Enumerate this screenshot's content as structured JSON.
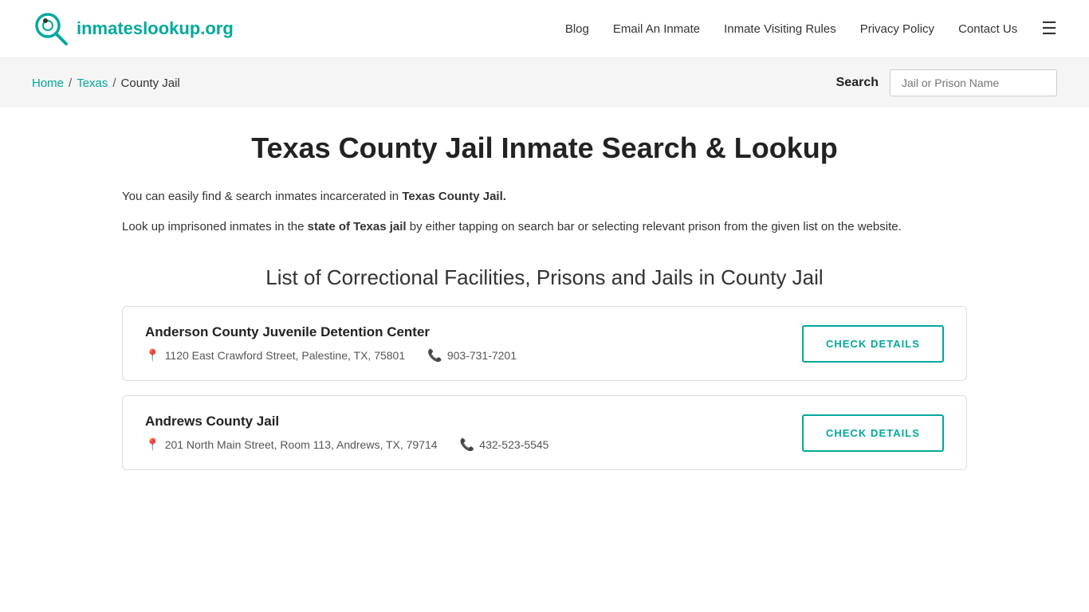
{
  "header": {
    "logo_text_regular": "inmates",
    "logo_text_bold": "lookup.org",
    "nav": [
      {
        "label": "Blog",
        "href": "#"
      },
      {
        "label": "Email An Inmate",
        "href": "#"
      },
      {
        "label": "Inmate Visiting Rules",
        "href": "#"
      },
      {
        "label": "Privacy Policy",
        "href": "#"
      },
      {
        "label": "Contact Us",
        "href": "#"
      }
    ]
  },
  "breadcrumb": {
    "home": "Home",
    "state": "Texas",
    "current": "County Jail"
  },
  "search": {
    "label": "Search",
    "placeholder": "Jail or Prison Name"
  },
  "page": {
    "title": "Texas County Jail Inmate Search & Lookup",
    "intro1_plain": "You can easily find & search inmates incarcerated in ",
    "intro1_bold": "Texas County Jail.",
    "intro2_plain1": "Look up imprisoned inmates in the ",
    "intro2_bold": "state of Texas jail",
    "intro2_plain2": " by either tapping on search bar or selecting relevant prison from the given list on the website.",
    "section_title": "List of Correctional Facilities, Prisons and Jails in County Jail"
  },
  "facilities": [
    {
      "name": "Anderson County Juvenile Detention Center",
      "address": "1120 East Crawford Street, Palestine, TX, 75801",
      "phone": "903-731-7201",
      "btn_label": "CHECK DETAILS"
    },
    {
      "name": "Andrews County Jail",
      "address": "201 North Main Street, Room 113, Andrews, TX, 79714",
      "phone": "432-523-5545",
      "btn_label": "CHECK DETAILS"
    }
  ]
}
